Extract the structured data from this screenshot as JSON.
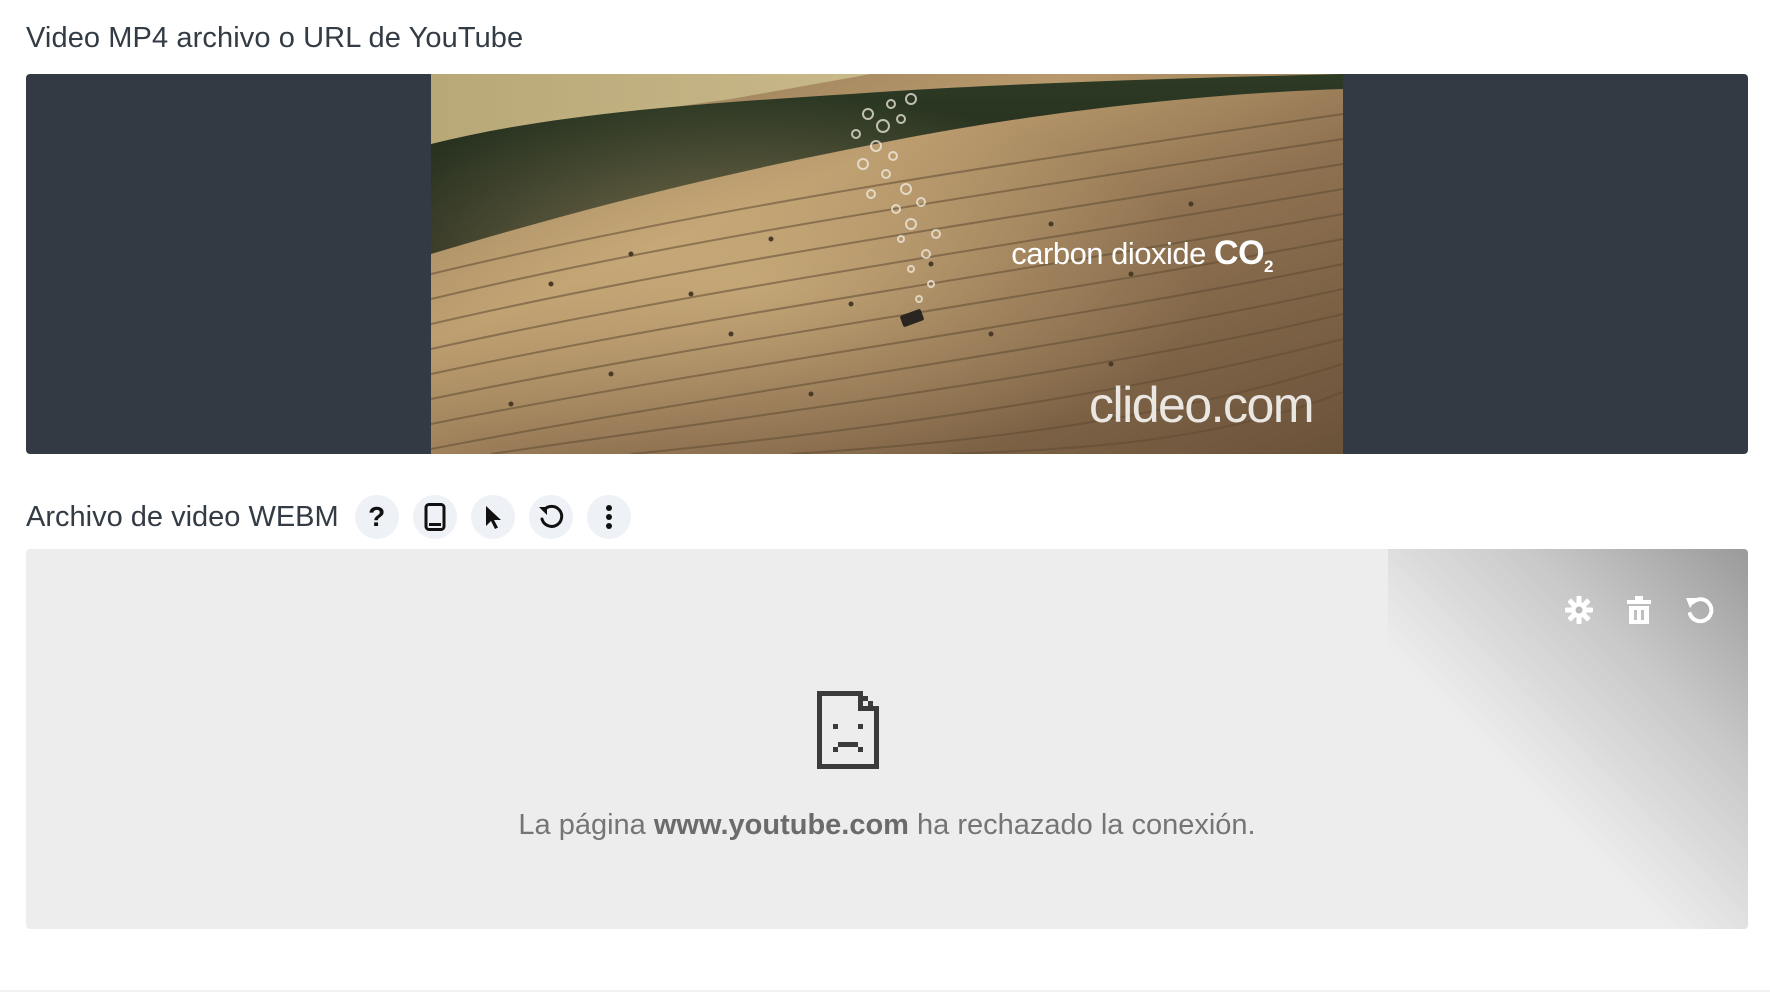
{
  "mp4_field": {
    "label": "Video MP4 archivo o URL de YouTube",
    "overlay_text_prefix": "carbon dioxide",
    "overlay_text_formula": "CO",
    "overlay_text_subscript": "2",
    "watermark": "clideo.com"
  },
  "webm_field": {
    "label": "Archivo de video WEBM",
    "toolbar": {
      "help_label": "?",
      "icons": [
        "help-icon",
        "phone-icon",
        "cursor-icon",
        "undo-icon",
        "more-vertical-icon"
      ]
    },
    "embed_actions": [
      "gear-icon",
      "trash-icon",
      "undo-icon"
    ],
    "error": {
      "prefix": "La página",
      "domain": "www.youtube.com",
      "suffix": "ha rechazado la conexión."
    }
  },
  "colors": {
    "video_bg": "#333a44",
    "embed_bg": "#ededed",
    "toolbar_btn_bg": "#eef1f5"
  }
}
